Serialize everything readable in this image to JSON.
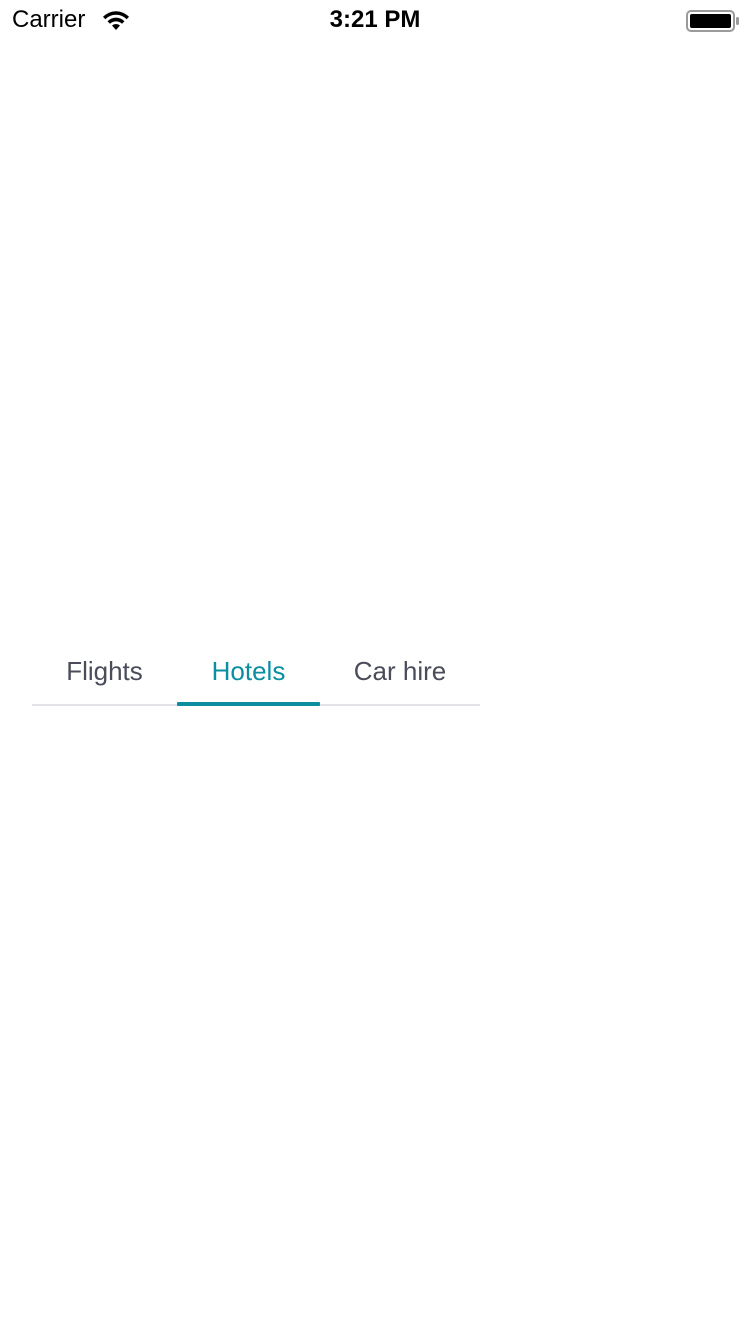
{
  "status_bar": {
    "carrier": "Carrier",
    "time": "3:21 PM",
    "wifi_icon": "wifi-icon",
    "battery_icon": "battery-icon",
    "battery_level": 1.0
  },
  "tabs": {
    "items": [
      {
        "label": "Flights",
        "selected": false
      },
      {
        "label": "Hotels",
        "selected": true
      },
      {
        "label": "Car hire",
        "selected": false
      }
    ],
    "colors": {
      "selected": "#0a8ea0",
      "unselected": "#4a4c5a",
      "rule": "#e3e4e7"
    }
  }
}
